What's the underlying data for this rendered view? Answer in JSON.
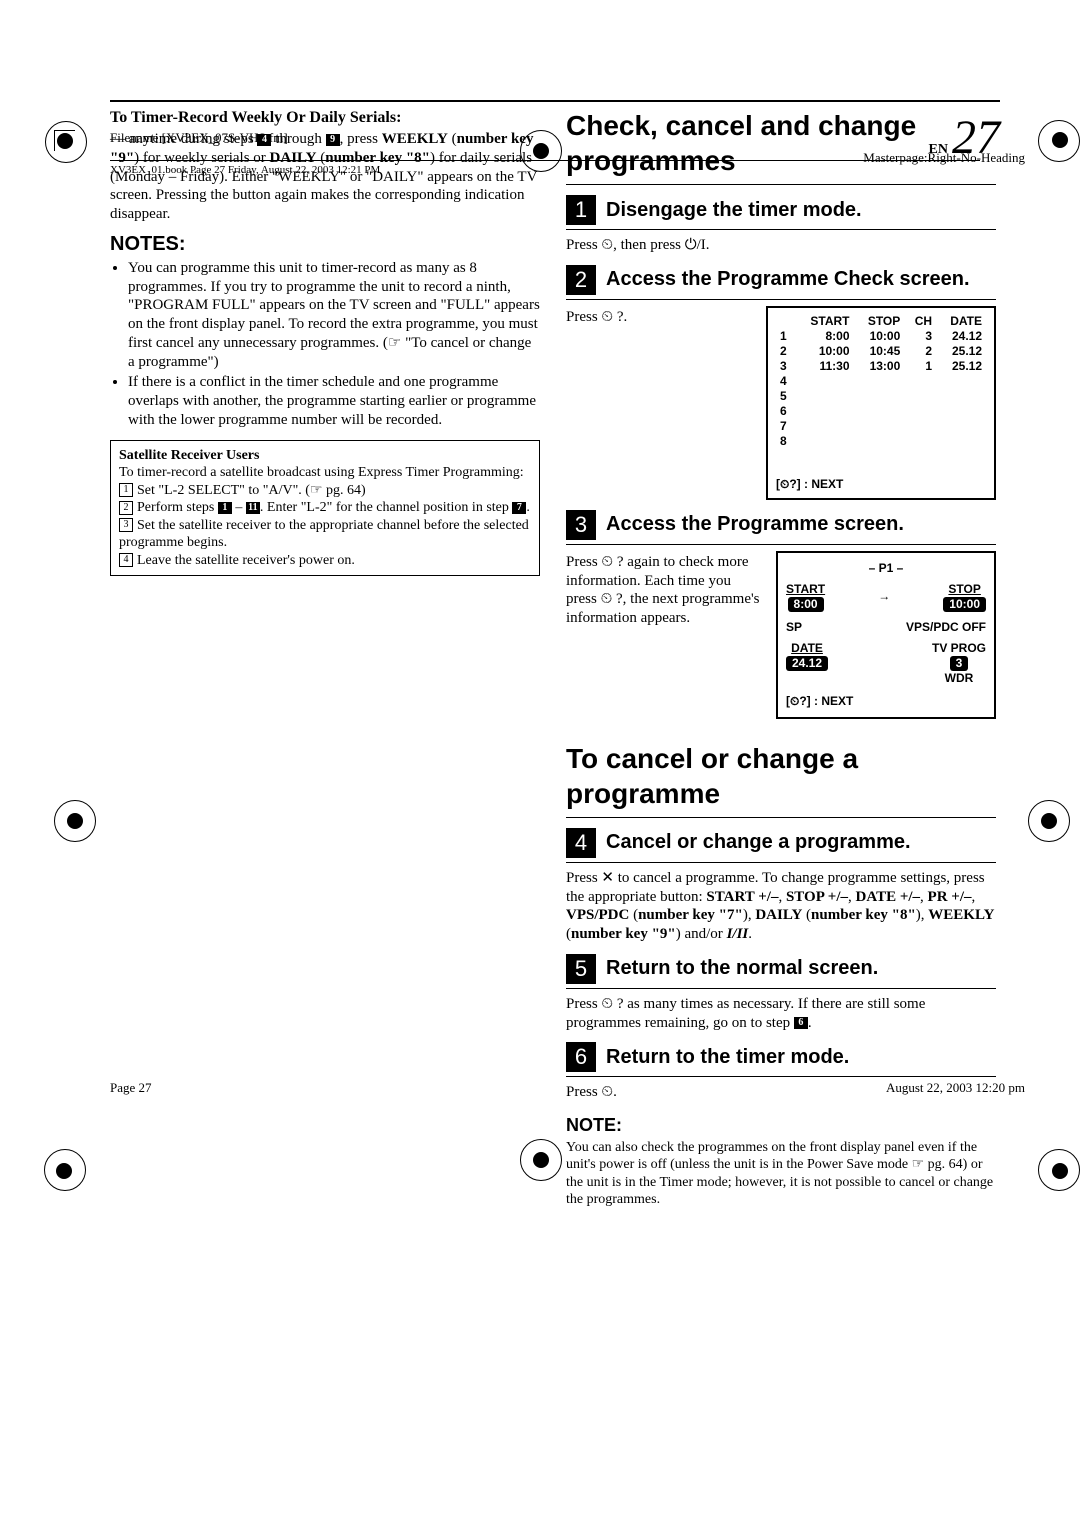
{
  "meta": {
    "filename": "Filename [XV3EX_07S-VHS.fm]",
    "booktag": "XV3EX_01.book  Page 27  Friday, August 22, 2003  12:21 PM",
    "masterpage": "Masterpage:Right-No-Heading",
    "footer_left": "Page 27",
    "footer_right": "August 22, 2003  12:20 pm",
    "page_en": "EN",
    "page_num": "27"
  },
  "left": {
    "serials_head": "To Timer-Record Weekly Or Daily Serials:",
    "serials_p1a": "— anytime during steps ",
    "serials_sq1": "4",
    "serials_p1b": " through ",
    "serials_sq2": "9",
    "serials_p1c": ", press ",
    "serials_weekly": "WEEKLY",
    "serials_p1d": " (",
    "serials_numkey9": "number key \"9\"",
    "serials_p1e": ") for weekly serials or ",
    "serials_daily": "DAILY",
    "serials_p1f": " (",
    "serials_numkey8": "number key \"8\"",
    "serials_p1g": ") for daily serials (Monday – Friday). Either \"WEEKLY\" or \"DAILY\" appears on the TV screen. Pressing the button again makes the corresponding indication disappear.",
    "notes_head": "NOTES:",
    "note1": "You can programme this unit to timer-record as many as 8 programmes. If you try to programme the unit to record a ninth, \"PROGRAM FULL\" appears on the TV screen and \"FULL\" appears on the front display panel. To record the extra programme, you must first cancel any unnecessary programmes. (☞ \"To cancel or change a programme\")",
    "note2": "If there is a conflict in the timer schedule and one programme overlaps with another, the programme starting earlier or programme with the lower programme number will be recorded.",
    "box_title": "Satellite Receiver Users",
    "box_intro": "To timer-record a satellite broadcast using Express Timer Programming:",
    "box_step1": "Set \"L-2 SELECT\" to \"A/V\". (☞ pg. 64)",
    "box_step2a": "Perform steps ",
    "box_step2_sq1": "1",
    "box_step2b": " – ",
    "box_step2_sq2": "11",
    "box_step2c": ". Enter \"L-2\" for the channel position in step ",
    "box_step2_sq3": "7",
    "box_step2d": ".",
    "box_step3": "Set the satellite receiver to the appropriate channel before the selected programme begins.",
    "box_step4": "Leave the satellite receiver's power on."
  },
  "right": {
    "h1": "Check, cancel and change programmes",
    "s1_title": "Disengage the timer mode.",
    "s1_body": "Press ⏲, then press ⏻/I.",
    "s2_title": "Access the Programme Check screen.",
    "s2_body": "Press ⏲ ?.",
    "osd1": {
      "headers": [
        "",
        "START",
        "STOP",
        "CH",
        "DATE"
      ],
      "rows": [
        [
          "1",
          "8:00",
          "10:00",
          "3",
          "24.12"
        ],
        [
          "2",
          "10:00",
          "10:45",
          "2",
          "25.12"
        ],
        [
          "3",
          "11:30",
          "13:00",
          "1",
          "25.12"
        ],
        [
          "4",
          "",
          "",
          "",
          ""
        ],
        [
          "5",
          "",
          "",
          "",
          ""
        ],
        [
          "6",
          "",
          "",
          "",
          ""
        ],
        [
          "7",
          "",
          "",
          "",
          ""
        ],
        [
          "8",
          "",
          "",
          "",
          ""
        ]
      ],
      "foot": "[⏲?] : NEXT"
    },
    "s3_title": "Access the Programme screen.",
    "s3_body": "Press ⏲ ? again to check more information. Each time you press ⏲ ?, the next programme's information appears.",
    "osd2": {
      "title": "– P1 –",
      "start_l": "START",
      "start_v": "8:00",
      "stop_l": "STOP",
      "stop_v": "10:00",
      "sp": "SP",
      "vps": "VPS/PDC OFF",
      "date_l": "DATE",
      "date_v": "24.12",
      "tvprog": "TV PROG",
      "ch": "3",
      "wdr": "WDR",
      "foot": "[⏲?] : NEXT"
    },
    "h2": "To cancel or change a programme",
    "s4_title": "Cancel or change a programme.",
    "s4_body_a": "Press ✕ to cancel a programme. To change programme settings, press the appropriate button: ",
    "s4_body_b": "START +/–",
    "s4_body_c": ", ",
    "s4_body_d": "STOP +/–",
    "s4_body_e": ", ",
    "s4_body_f": "DATE +/–",
    "s4_body_g": ", ",
    "s4_body_h": "PR +/–",
    "s4_body_i": ", ",
    "s4_body_j": "VPS/PDC",
    "s4_body_k": " (",
    "s4_body_l": "number key \"7\"",
    "s4_body_m": "), ",
    "s4_body_n": "DAILY",
    "s4_body_o": " (",
    "s4_body_p": "number key \"8\"",
    "s4_body_q": "), ",
    "s4_body_r": "WEEKLY",
    "s4_body_s": " (",
    "s4_body_t": "number key \"9\"",
    "s4_body_u": ") and/or ",
    "s4_body_v": "I/II",
    "s4_body_w": ".",
    "s5_title": "Return to the normal screen.",
    "s5_body_a": "Press ⏲ ? as many times as necessary. If there are still some programmes remaining, go on to step ",
    "s5_sq": "6",
    "s5_body_b": ".",
    "s6_title": "Return to the timer mode.",
    "s6_body": "Press ⏲.",
    "note_h": "NOTE:",
    "note_body": "You can also check the programmes on the front display panel even if the unit's power is off (unless the unit is in the Power Save mode ☞ pg. 64) or the unit is in the Timer mode; however, it is not possible to cancel or change the programmes."
  }
}
